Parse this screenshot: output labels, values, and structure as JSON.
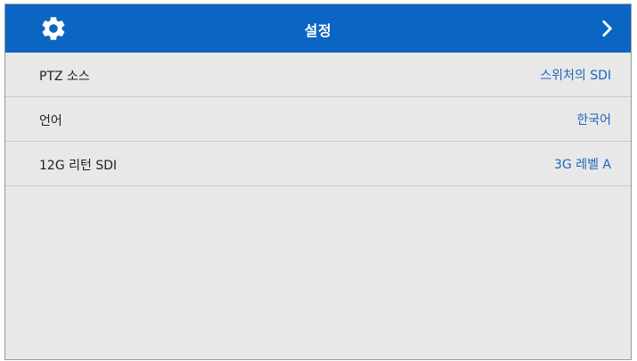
{
  "header": {
    "title": "설정",
    "left_icon": "gear-icon",
    "right_icon": "chevron-right-icon",
    "background_color": "#0b66c3"
  },
  "settings": [
    {
      "label": "PTZ 소스",
      "value": "스위처의 SDI"
    },
    {
      "label": "언어",
      "value": "한국어"
    },
    {
      "label": "12G 리턴 SDI",
      "value": "3G 레벨 A"
    }
  ],
  "colors": {
    "value_text": "#1a66bd",
    "panel_background": "#e8e8e8"
  }
}
